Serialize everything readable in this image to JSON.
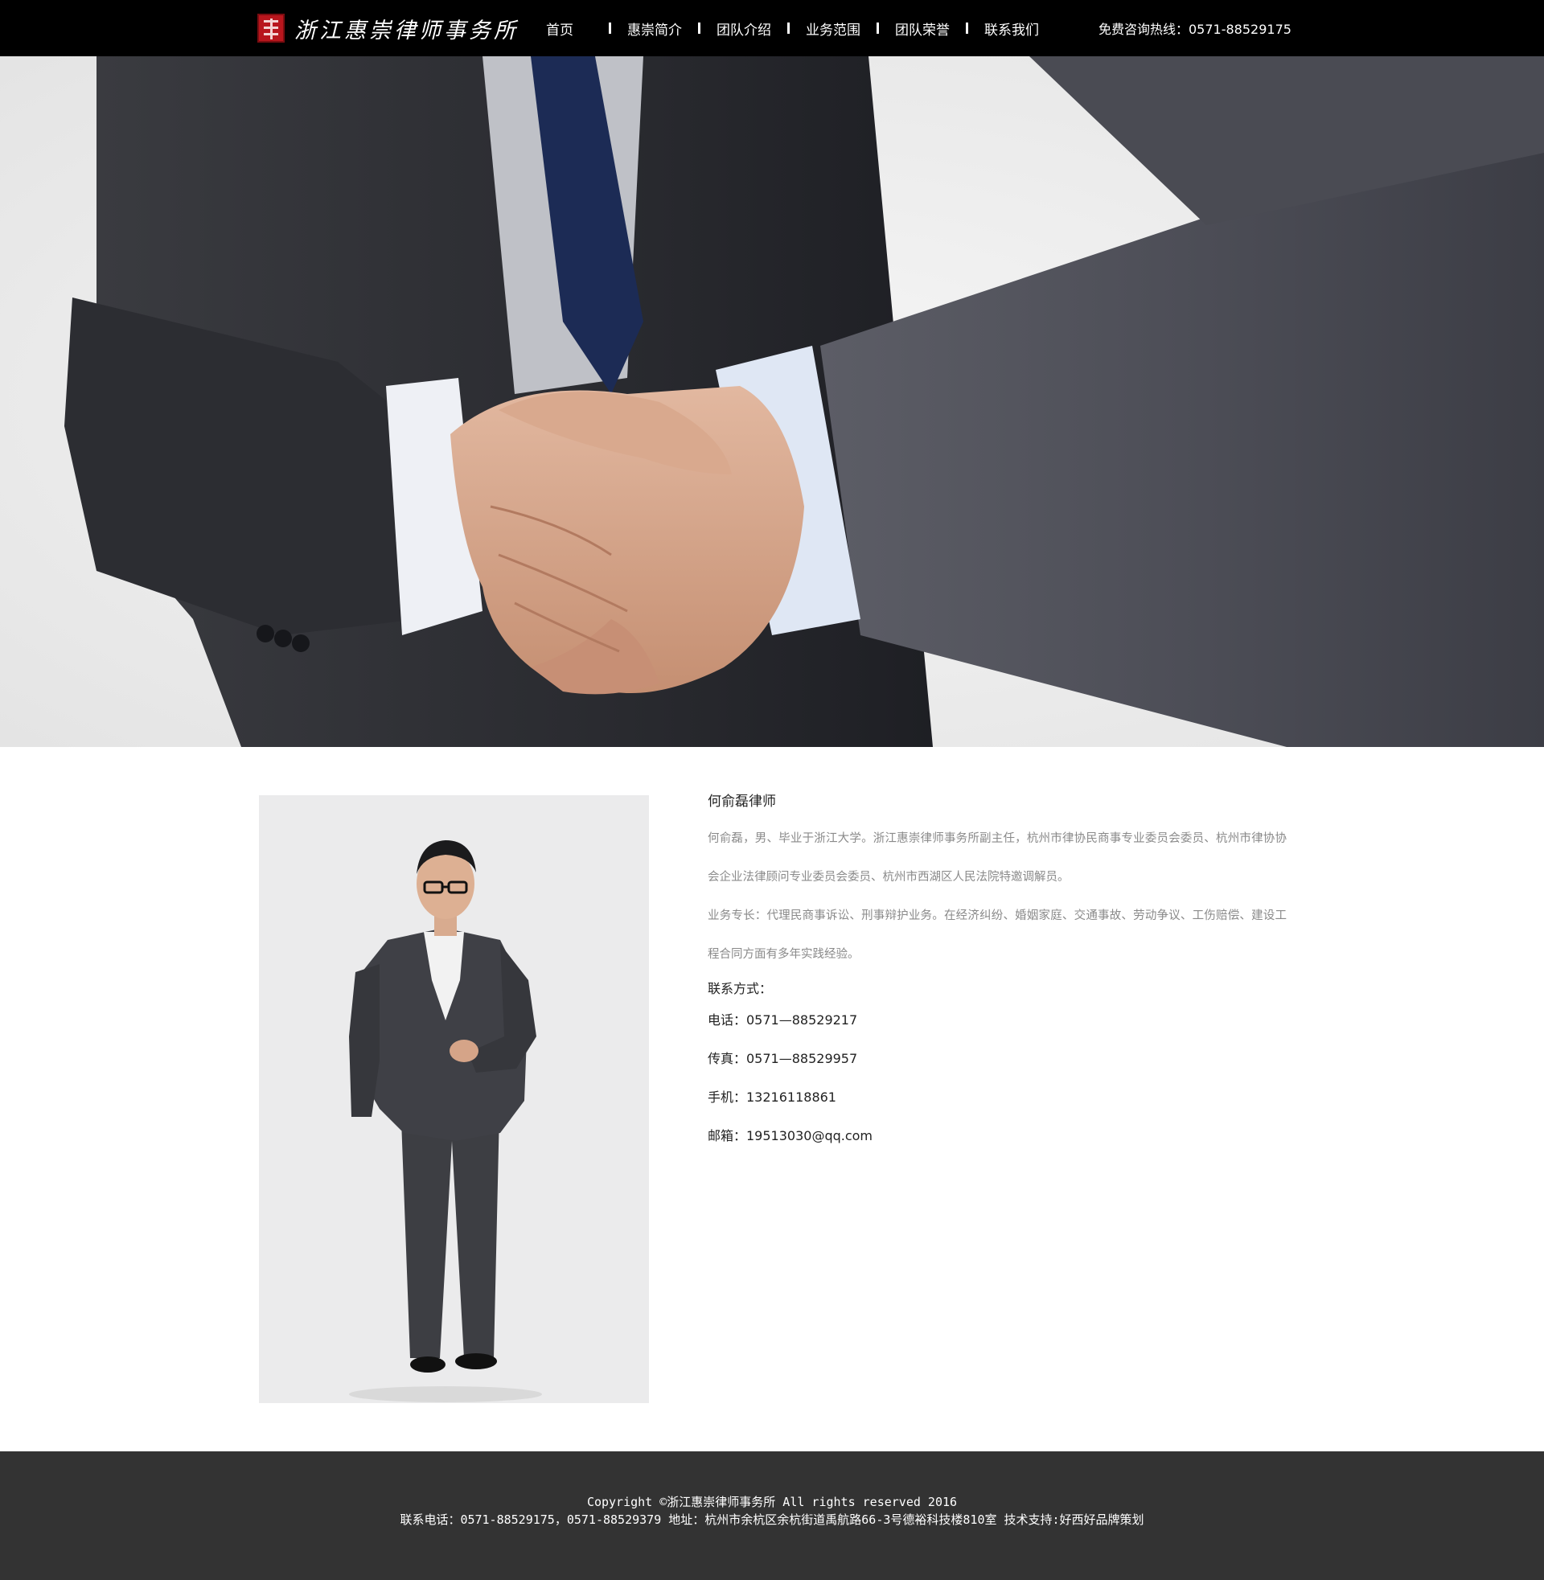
{
  "header": {
    "logo_text": "浙江惠崇律师事务所",
    "nav": [
      "首页",
      "惠崇简介",
      "团队介绍",
      "业务范围",
      "团队荣誉",
      "联系我们"
    ],
    "hotline": "免费咨询热线：0571-88529175"
  },
  "hero": {
    "image": "handshake-photo"
  },
  "profile": {
    "photo": "lawyer-portrait-photo",
    "name": "何俞磊律师",
    "bio": "何俞磊，男、毕业于浙江大学。浙江惠崇律师事务所副主任，杭州市律协民商事专业委员会委员、杭州市律协协会企业法律顾问专业委员会委员、杭州市西湖区人民法院特邀调解员。",
    "expertise": "业务专长：代理民商事诉讼、刑事辩护业务。在经济纠纷、婚姻家庭、交通事故、劳动争议、工伤赔偿、建设工程合同方面有多年实践经验。",
    "contact_title": "联系方式：",
    "phone": "电话：0571—88529217",
    "fax": "传真：0571—88529957",
    "mobile": "手机：13216118861",
    "email": "邮箱：19513030@qq.com"
  },
  "footer": {
    "copyright": "Copyright ©浙江惠崇律师事务所 All rights reserved 2016",
    "contact": "联系电话：0571-88529175，0571-88529379 地址：杭州市余杭区余杭街道禹航路66-3号德裕科技楼810室 技术支持:好西好品牌策划"
  }
}
